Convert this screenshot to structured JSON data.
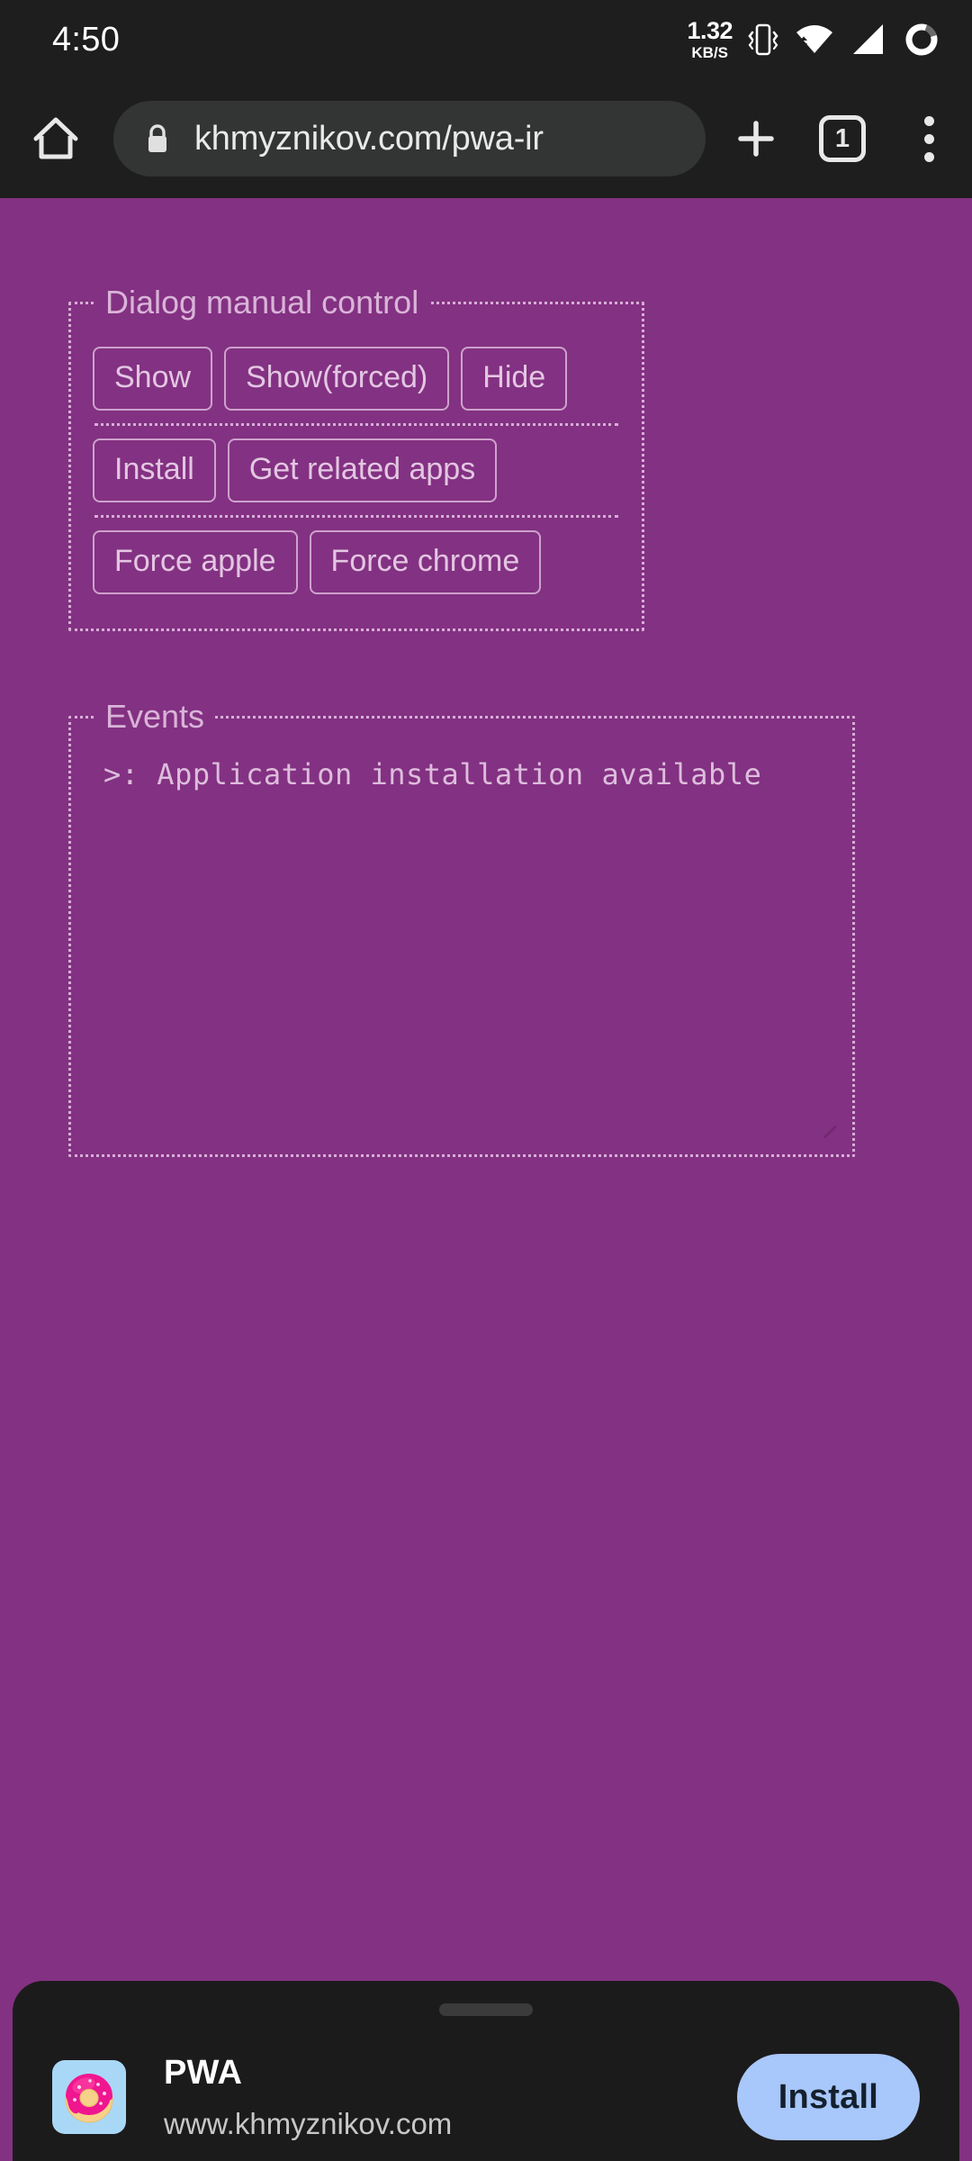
{
  "status_bar": {
    "clock": "4:50",
    "net_speed_value": "1.32",
    "net_speed_unit": "KB/S",
    "icons": [
      "vibrate-icon",
      "wifi-icon",
      "signal-icon",
      "battery-ring-icon"
    ]
  },
  "toolbar": {
    "home_icon": "home-icon",
    "lock_icon": "lock-icon",
    "url": "khmyznikov.com/pwa-ir",
    "new_tab_icon": "plus-icon",
    "tab_count": "1",
    "menu_icon": "more-vertical-icon"
  },
  "page": {
    "background_color": "#833182",
    "dialog_control": {
      "legend": "Dialog manual control",
      "rows": [
        [
          "Show",
          "Show(forced)",
          "Hide"
        ],
        [
          "Install",
          "Get related apps"
        ],
        [
          "Force apple",
          "Force chrome"
        ]
      ]
    },
    "events": {
      "legend": "Events",
      "lines": [
        ">: Application installation available"
      ]
    }
  },
  "install_prompt": {
    "app_name": "PWA",
    "app_url": "www.khmyznikov.com",
    "install_label": "Install",
    "app_icon": "donut-icon",
    "icon_background": "#a9d8f7",
    "install_button_color": "#a8c7fa"
  }
}
